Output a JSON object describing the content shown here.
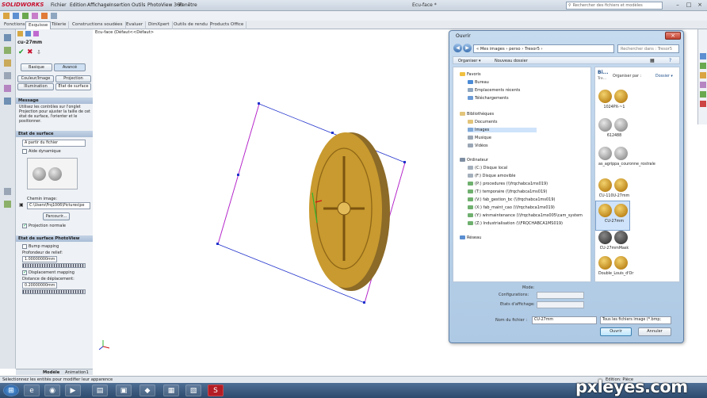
{
  "app": {
    "brand": "SOLIDWORKS",
    "window_title": "Ecu-face *",
    "search_placeholder": "Rechercher des fichiers et modèles"
  },
  "menu": [
    "Fichier",
    "Edition",
    "Affichage",
    "Insertion",
    "Outils",
    "PhotoView 360",
    "Fenêtre"
  ],
  "tabs": [
    "Fonctions",
    "Esquisse",
    "Tôlerie",
    "Constructions soudées",
    "Evaluer",
    "DimXpert",
    "Outils de rendu",
    "Products Office"
  ],
  "active_tab": 1,
  "property_manager": {
    "title": "cu-27mm",
    "btn_basic": "Basique",
    "btn_advanced": "Avancé",
    "subtabs": [
      "Couleur/Image",
      "Projection",
      "Illumination",
      "Etat de surface"
    ],
    "message_head": "Message",
    "message": "Utilisez les contrôles sur l'onglet Projection pour ajuster la taille de cet état de surface, l'orienter et le positionner.",
    "surface_head": "Etat de surface",
    "surface_select": "A partir du fichier",
    "dynamic_help": "Aide dynamique",
    "image_path_label": "Chemin image:",
    "image_path": "C:\\Users\\Frq1006\\Pictures\\pe",
    "browse": "Parcourir...",
    "normal_projection": "Projection normale",
    "pv_head": "Etat de surface PhotoView",
    "bump": "Bump mapping",
    "bump_depth_label": "Profondeur de relief:",
    "bump_depth": "1.00000000mm",
    "displacement": "Displacement mapping",
    "disp_label": "Distance de déplacement:",
    "disp_value": "0.20000000mm"
  },
  "feature_tree": {
    "root": "Ecu-face (Défaut<<Défaut>"
  },
  "bottom_tabs": [
    "Modèle",
    "Animation1"
  ],
  "status": {
    "left": "Sélectionnez les entités pour modifier leur apparence",
    "right": "Edition: Pièce"
  },
  "dialog": {
    "title": "Ouvrir",
    "path": "« Mes images › perso › Tresor5 ›",
    "search_placeholder": "Rechercher dans : Tresor5",
    "organize": "Organiser ▾",
    "new_folder": "Nouveau dossier",
    "lib_label": "Bi...",
    "lib_sub": "Tre...",
    "arrange": "Organiser par :",
    "arrange_val": "Dossier ▾",
    "nav": {
      "favorites": "Favoris",
      "fav_items": [
        "Bureau",
        "Emplacements récents",
        "Téléchargements"
      ],
      "libraries": "Bibliothèques",
      "lib_items": [
        "Documents",
        "Images",
        "Musique",
        "Vidéos"
      ],
      "computer": "Ordinateur",
      "drives": [
        "(C:) Disque local",
        "(F:) Disque amovible",
        "(P:) procedures (\\\\frqchabca1ms019)",
        "(T:) temporaire (\\\\frqchabca1ms019)",
        "(V:) fab_gestion_bc (\\\\frqchabca1ms019)",
        "(X:) fab_maint_cao (\\\\frqchabca1ms019)",
        "(Y:) winmaintenance (\\\\frqchabca1ms005\\cam_system",
        "(Z:) Industrialisation (\\\\FRQCHABCA1MS019)"
      ],
      "network": "Réseau"
    },
    "files": [
      "1024PX-~1",
      "612488",
      "as_agrippa_couronne_rostrale",
      "CU-110U-27mm",
      "CU-27mm",
      "CU-27mmMask",
      "Double_Louis_d'Or"
    ],
    "mode_label": "Mode:",
    "config_label": "Configurations:",
    "display_label": "Etats d'affichage:",
    "filename_label": "Nom du fichier :",
    "filename": "CU-27mm",
    "filetype": "Tous les fichiers image (*.bmp;",
    "open": "Ouvrir",
    "cancel": "Annuler"
  },
  "watermark": "pxleyes.com",
  "colors": {
    "annotation": "#e0101a",
    "accent": "#3f74b4",
    "coin_gold": "#c89a2f"
  }
}
